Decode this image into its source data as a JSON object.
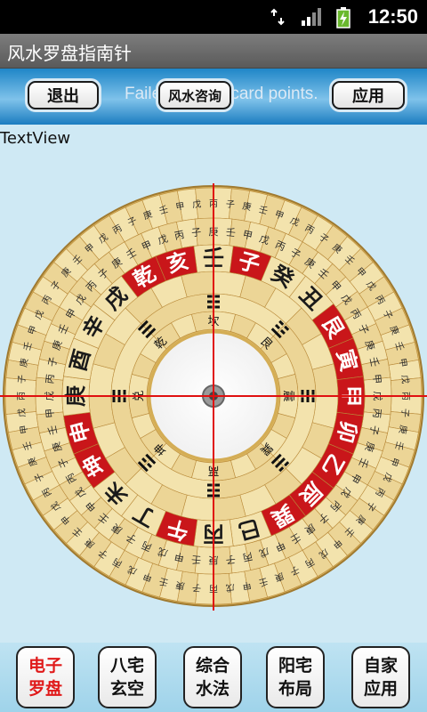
{
  "status": {
    "time": "12:50",
    "network": "3G"
  },
  "app": {
    "title": "风水罗盘指南针"
  },
  "toolbar": {
    "exit_label": "退出",
    "consult_label": "风水咨询",
    "apply_label": "应用",
    "toast_text": "Failed to load card points."
  },
  "textview": "TextView",
  "compass": {
    "center_label": "",
    "mountains": [
      "壬",
      "子",
      "癸",
      "丑",
      "艮",
      "寅",
      "甲",
      "卯",
      "乙",
      "辰",
      "巽",
      "巳",
      "丙",
      "午",
      "丁",
      "未",
      "坤",
      "申",
      "庚",
      "酉",
      "辛",
      "戌",
      "乾",
      "亥"
    ],
    "red_mountains": [
      "子",
      "艮",
      "寅",
      "甲",
      "卯",
      "乙",
      "辰",
      "巽",
      "午",
      "坤",
      "申",
      "乾",
      "亥"
    ],
    "inner_labels": [
      "坎",
      "艮",
      "震",
      "巽",
      "离",
      "坤",
      "兑",
      "乾"
    ],
    "colors": {
      "ring_light": "#f3e3ad",
      "ring_dark": "#d9b35c",
      "red": "#c9161a",
      "crosshair": "#e01010"
    }
  },
  "bottom_nav": [
    {
      "label": "电子\n罗盘",
      "active": true
    },
    {
      "label": "八宅\n玄空",
      "active": false
    },
    {
      "label": "综合\n水法",
      "active": false
    },
    {
      "label": "阳宅\n布局",
      "active": false
    },
    {
      "label": "自家\n应用",
      "active": false
    }
  ]
}
